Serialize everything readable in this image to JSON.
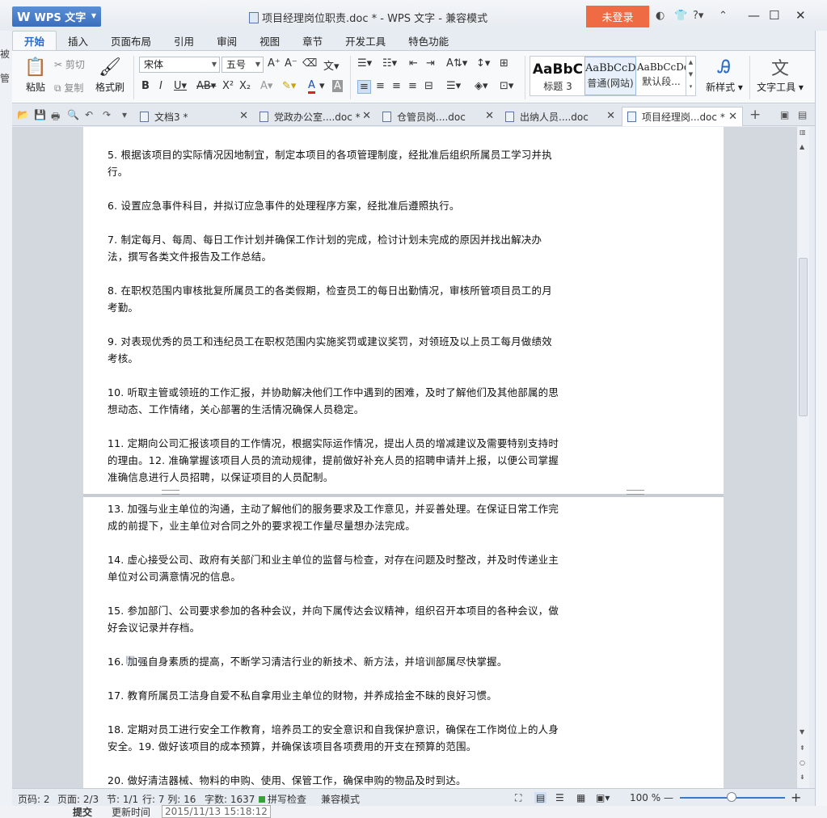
{
  "app": {
    "name": "WPS 文字",
    "title": "项目经理岗位职责.doc * - WPS 文字 - 兼容模式",
    "login": "未登录"
  },
  "ribbon_tabs": [
    "开始",
    "插入",
    "页面布局",
    "引用",
    "审阅",
    "视图",
    "章节",
    "开发工具",
    "特色功能"
  ],
  "ribbon": {
    "paste": "粘贴",
    "cut": "剪切",
    "copy": "复制",
    "format_painter": "格式刷",
    "font": "宋体",
    "size": "五号",
    "styles": [
      {
        "preview": "AaBbC",
        "name": "标题 3"
      },
      {
        "preview": "AaBbCcD",
        "name": "普通(网站)"
      },
      {
        "preview": "AaBbCcDd",
        "name": "默认段..."
      }
    ],
    "new_style": "新样式",
    "text_tools": "文字工具"
  },
  "doc_tabs": [
    {
      "label": "文档3 *",
      "active": false
    },
    {
      "label": "党政办公室....doc *",
      "active": false
    },
    {
      "label": "仓管员岗....doc",
      "active": false
    },
    {
      "label": "出纳人员....doc",
      "active": false
    },
    {
      "label": "项目经理岗...doc *",
      "active": true
    }
  ],
  "paragraphs_page1": [
    "5. 根据该项目的实际情况因地制宜，制定本项目的各项管理制度，经批准后组织所属员工学习并执行。",
    "6. 设置应急事件科目，并拟订应急事件的处理程序方案，经批准后遵照执行。",
    "7. 制定每月、每周、每日工作计划并确保工作计划的完成，检讨计划未完成的原因并找出解决办法，撰写各类文件报告及工作总结。",
    "8. 在职权范围内审核批复所属员工的各类假期，检查员工的每日出勤情况，审核所管项目员工的月考勤。",
    "9. 对表现优秀的员工和违纪员工在职权范围内实施奖罚或建议奖罚，对领班及以上员工每月做绩效考核。",
    "10. 听取主管或领班的工作汇报，并协助解决他们工作中遇到的困难，及时了解他们及其他部属的思想动态、工作情绪，关心部署的生活情况确保人员稳定。",
    "11. 定期向公司汇报该项目的工作情况，根据实际运作情况，提出人员的增减建议及需要特别支持时的理由。12. 准确掌握该项目人员的流动规律，提前做好补充人员的招聘申请并上报，以便公司掌握准确信息进行人员招聘，以保证项目的人员配制。"
  ],
  "paragraphs_page2": [
    "13. 加强与业主单位的沟通，主动了解他们的服务要求及工作意见，并妥善处理。在保证日常工作完成的前提下，业主单位对合同之外的要求视工作量尽量想办法完成。",
    "14. 虚心接受公司、政府有关部门和业主单位的监督与检查，对存在问题及时整改，并及时传递业主单位对公司满意情况的信息。",
    "15. 参加部门、公司要求参加的各种会议，并向下属传达会议精神，组织召开本项目的各种会议，做好会议记录并存档。",
    "16. 加强自身素质的提高，不断学习清洁行业的新技术、新方法，并培训部属尽快掌握。",
    "17. 教育所属员工洁身自爱不私自拿用业主单位的财物，并养成拾金不昧的良好习惯。",
    "18. 定期对员工进行安全工作教育，培养员工的安全意识和自我保护意识，确保在工作岗位上的人身安全。19. 做好该项目的成本预算，并确保该项目各项费用的开支在预算的范围。",
    "20. 做好清洁器械、物料的申购、使用、保管工作，确保申购的物品及时到达。"
  ],
  "status": {
    "page_num": "页码: 2",
    "pages": "页面: 2/3",
    "section": "节: 1/1",
    "row_col": "行: 7  列: 16",
    "words": "字数: 1637",
    "spellcheck": "拼写检查",
    "mode": "兼容模式",
    "zoom": "100 %",
    "zoom_value": 100
  },
  "background": {
    "submit": "提交",
    "update_time_label": "更新时间",
    "update_time": "2015/11/13 15:18:12",
    "left_chars": [
      "被",
      "管"
    ]
  },
  "colors": {
    "accent": "#2a6bc4",
    "login_bg": "#ee6b44",
    "app_btn": "#3b6fbd"
  }
}
